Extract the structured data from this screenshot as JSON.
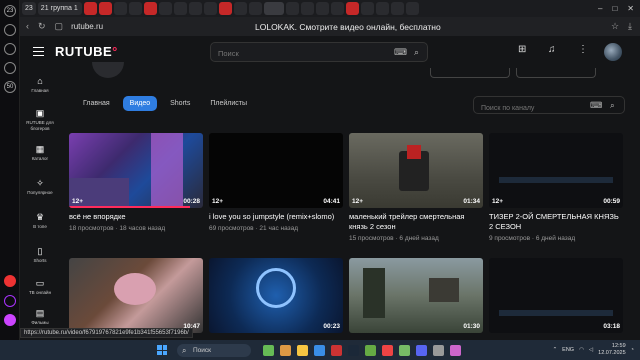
{
  "browser": {
    "tabs": [
      "23",
      "21 группа 1",
      "",
      "",
      "",
      "",
      "",
      "",
      "",
      "",
      "",
      "",
      "",
      "",
      "",
      "",
      "",
      "",
      "",
      "",
      "",
      "",
      "",
      "",
      "",
      "",
      ""
    ],
    "tab_count_badge": "23",
    "address": "rutube.ru",
    "page_title": "LOLOKAK. Смотрите видео онлайн, бесплатно",
    "status_url": "https://rutube.ru/video/f67919767821e9fe1b341f55653f7196b/"
  },
  "side_strip": [
    "23",
    "",
    "",
    "",
    "50"
  ],
  "header": {
    "logo": "RUTUBE",
    "search_placeholder": "Поиск"
  },
  "left_nav": [
    {
      "label": "Главная",
      "icon": "home-icon",
      "glyph": "⌂"
    },
    {
      "label": "RUTUBE для блогеров",
      "icon": "blogger-icon",
      "glyph": "▣"
    },
    {
      "label": "Каталог",
      "icon": "catalog-icon",
      "glyph": "▦"
    },
    {
      "label": "Популярное",
      "icon": "fire-icon",
      "glyph": "✧"
    },
    {
      "label": "В топе",
      "icon": "top-icon",
      "glyph": "♛"
    },
    {
      "label": "Shorts",
      "icon": "shorts-icon",
      "glyph": "▯"
    },
    {
      "label": "ТВ онлайн",
      "icon": "tv-icon",
      "glyph": "▭"
    },
    {
      "label": "Фильмы",
      "icon": "film-icon",
      "glyph": "▤"
    }
  ],
  "channel_tabs": [
    {
      "label": "Главная",
      "active": false
    },
    {
      "label": "Видео",
      "active": true
    },
    {
      "label": "Shorts",
      "active": false
    },
    {
      "label": "Плейлисты",
      "active": false
    }
  ],
  "channel_search_placeholder": "Поиск по каналу",
  "videos": [
    {
      "title": "всё не впорядке",
      "views": "18 просмотров",
      "date": "18 часов назад",
      "age": "12+",
      "duration": "00:28",
      "progress": 0.9
    },
    {
      "title": "i love you so jumpstyle (remix+slomo)",
      "views": "69 просмотров",
      "date": "21 час назад",
      "age": "12+",
      "duration": "04:41",
      "progress": 0
    },
    {
      "title": "маленький трейлер смертельная князь 2 сезон",
      "views": "15 просмотров",
      "date": "6 дней назад",
      "age": "12+",
      "duration": "01:34",
      "progress": 0
    },
    {
      "title": "ТИЗЕР 2-ОЙ СМЕРТЕЛЬНАЯ КНЯЗЬ 2 СЕЗОН",
      "views": "9 просмотров",
      "date": "6 дней назад",
      "age": "12+",
      "duration": "00:59",
      "progress": 0
    },
    {
      "title": "",
      "views": "",
      "date": "",
      "age": "",
      "duration": "10:47",
      "progress": 0
    },
    {
      "title": "",
      "views": "",
      "date": "",
      "age": "",
      "duration": "00:23",
      "progress": 0
    },
    {
      "title": "",
      "views": "",
      "date": "",
      "age": "",
      "duration": "01:30",
      "progress": 0
    },
    {
      "title": "",
      "views": "",
      "date": "",
      "age": "",
      "duration": "03:18",
      "progress": 0
    }
  ],
  "taskbar": {
    "search_placeholder": "Поиск",
    "lang": "ENG",
    "time": "12:59",
    "date": "12.07.2025"
  },
  "colors": {
    "accent": "#2f7de1",
    "brand": "#ff2b5c",
    "bg": "#141517"
  }
}
